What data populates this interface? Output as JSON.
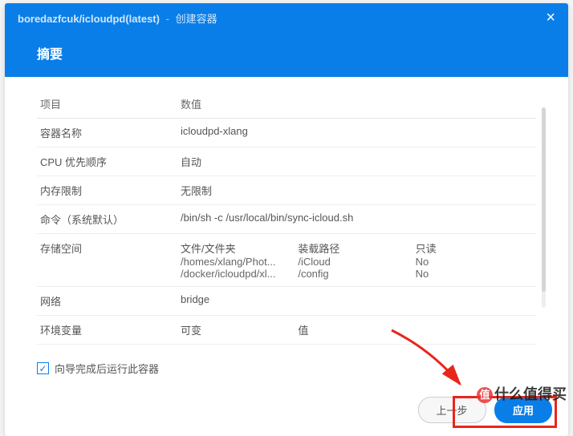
{
  "header": {
    "image_path": "boredazfcuk/icloudpd(latest)",
    "separator": "-",
    "action": "创建容器",
    "close": "×"
  },
  "section_title": "摘要",
  "columns": {
    "item": "项目",
    "value": "数值"
  },
  "rows": {
    "container_name": {
      "label": "容器名称",
      "value": "icloudpd-xlang"
    },
    "cpu_priority": {
      "label": "CPU 优先顺序",
      "value": "自动"
    },
    "memory_limit": {
      "label": "内存限制",
      "value": "无限制"
    },
    "command": {
      "label": "命令（系统默认）",
      "value": "/bin/sh -c /usr/local/bin/sync-icloud.sh"
    },
    "storage": {
      "label": "存储空间",
      "sub_headers": {
        "file": "文件/文件夹",
        "mount": "装载路径",
        "ro": "只读"
      },
      "entries": [
        {
          "file": "/homes/xlang/Phot...",
          "mount": "/iCloud",
          "ro": "No"
        },
        {
          "file": "/docker/icloudpd/xl...",
          "mount": "/config",
          "ro": "No"
        }
      ]
    },
    "network": {
      "label": "网络",
      "value": "bridge"
    },
    "env": {
      "label": "环境变量",
      "col1": "可变",
      "col2": "值"
    }
  },
  "checkbox": {
    "label": "向导完成后运行此容器",
    "checked": true
  },
  "buttons": {
    "prev": "上一步",
    "apply": "应用"
  },
  "watermark": "什么值得买"
}
